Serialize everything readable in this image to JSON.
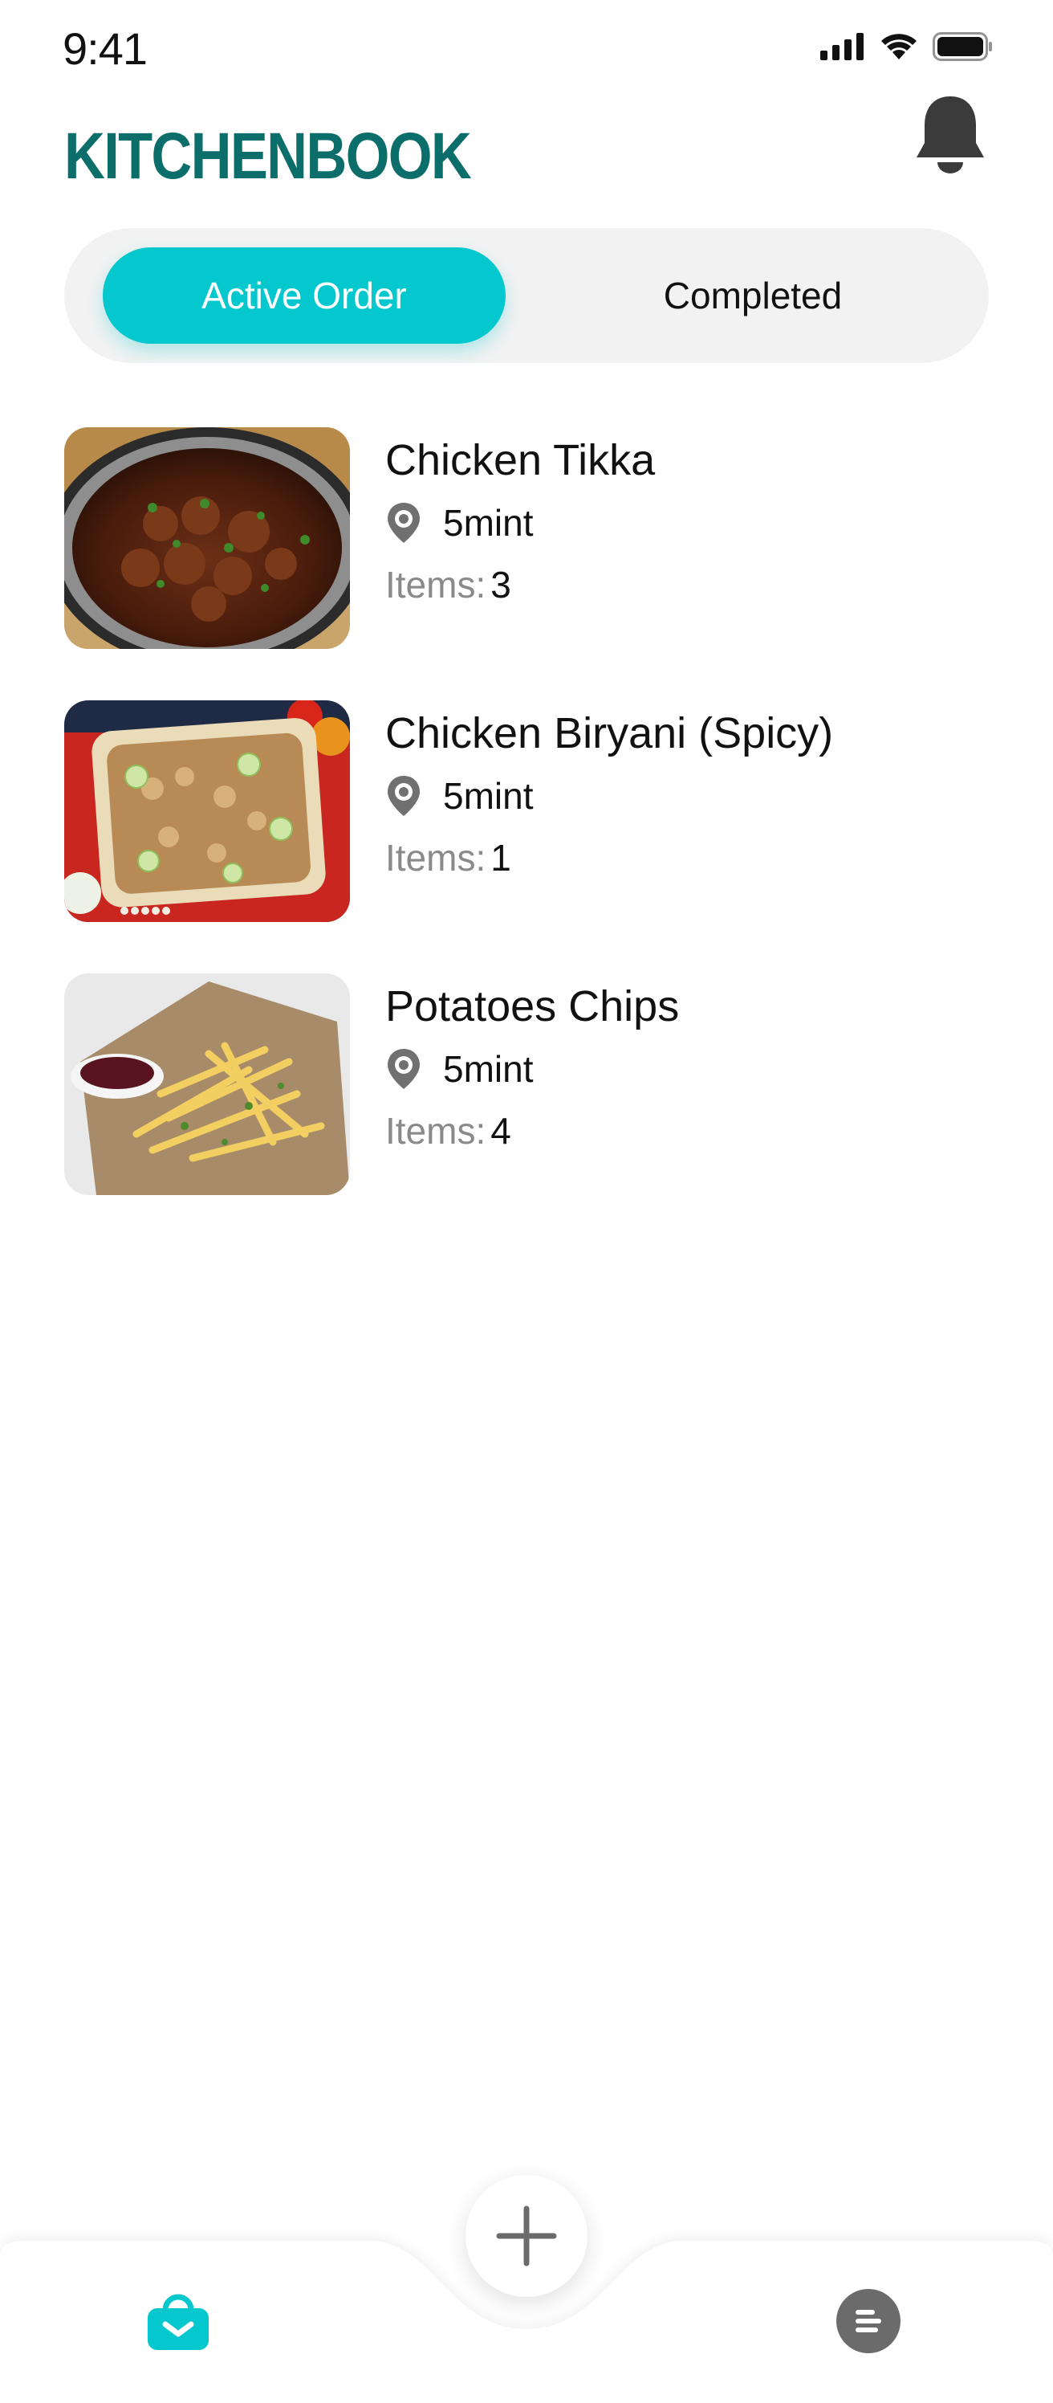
{
  "status_bar": {
    "time": "9:41"
  },
  "header": {
    "brand": "KITCHENBOOK"
  },
  "tabs": {
    "active_label": "Active Order",
    "inactive_label": "Completed"
  },
  "orders": [
    {
      "title": "Chicken Tikka",
      "time": "5mint",
      "items_label": "Items:",
      "items_count": "3"
    },
    {
      "title": "Chicken Biryani (Spicy)",
      "time": "5mint",
      "items_label": "Items:",
      "items_count": "1"
    },
    {
      "title": "Potatoes Chips",
      "time": "5mint",
      "items_label": "Items:",
      "items_count": "4"
    }
  ],
  "icons": {
    "status": [
      "signal-icon",
      "wifi-icon",
      "battery-icon"
    ],
    "header": "bell-icon",
    "order_meta": "location-pin-icon",
    "fab": "plus-icon",
    "nav": [
      "basket-icon",
      "menu-list-icon"
    ]
  },
  "colors": {
    "accent": "#05c8cf",
    "brand": "#0b6e6a",
    "muted": "#8a8a8a",
    "icon_gray": "#6b6b6b"
  }
}
